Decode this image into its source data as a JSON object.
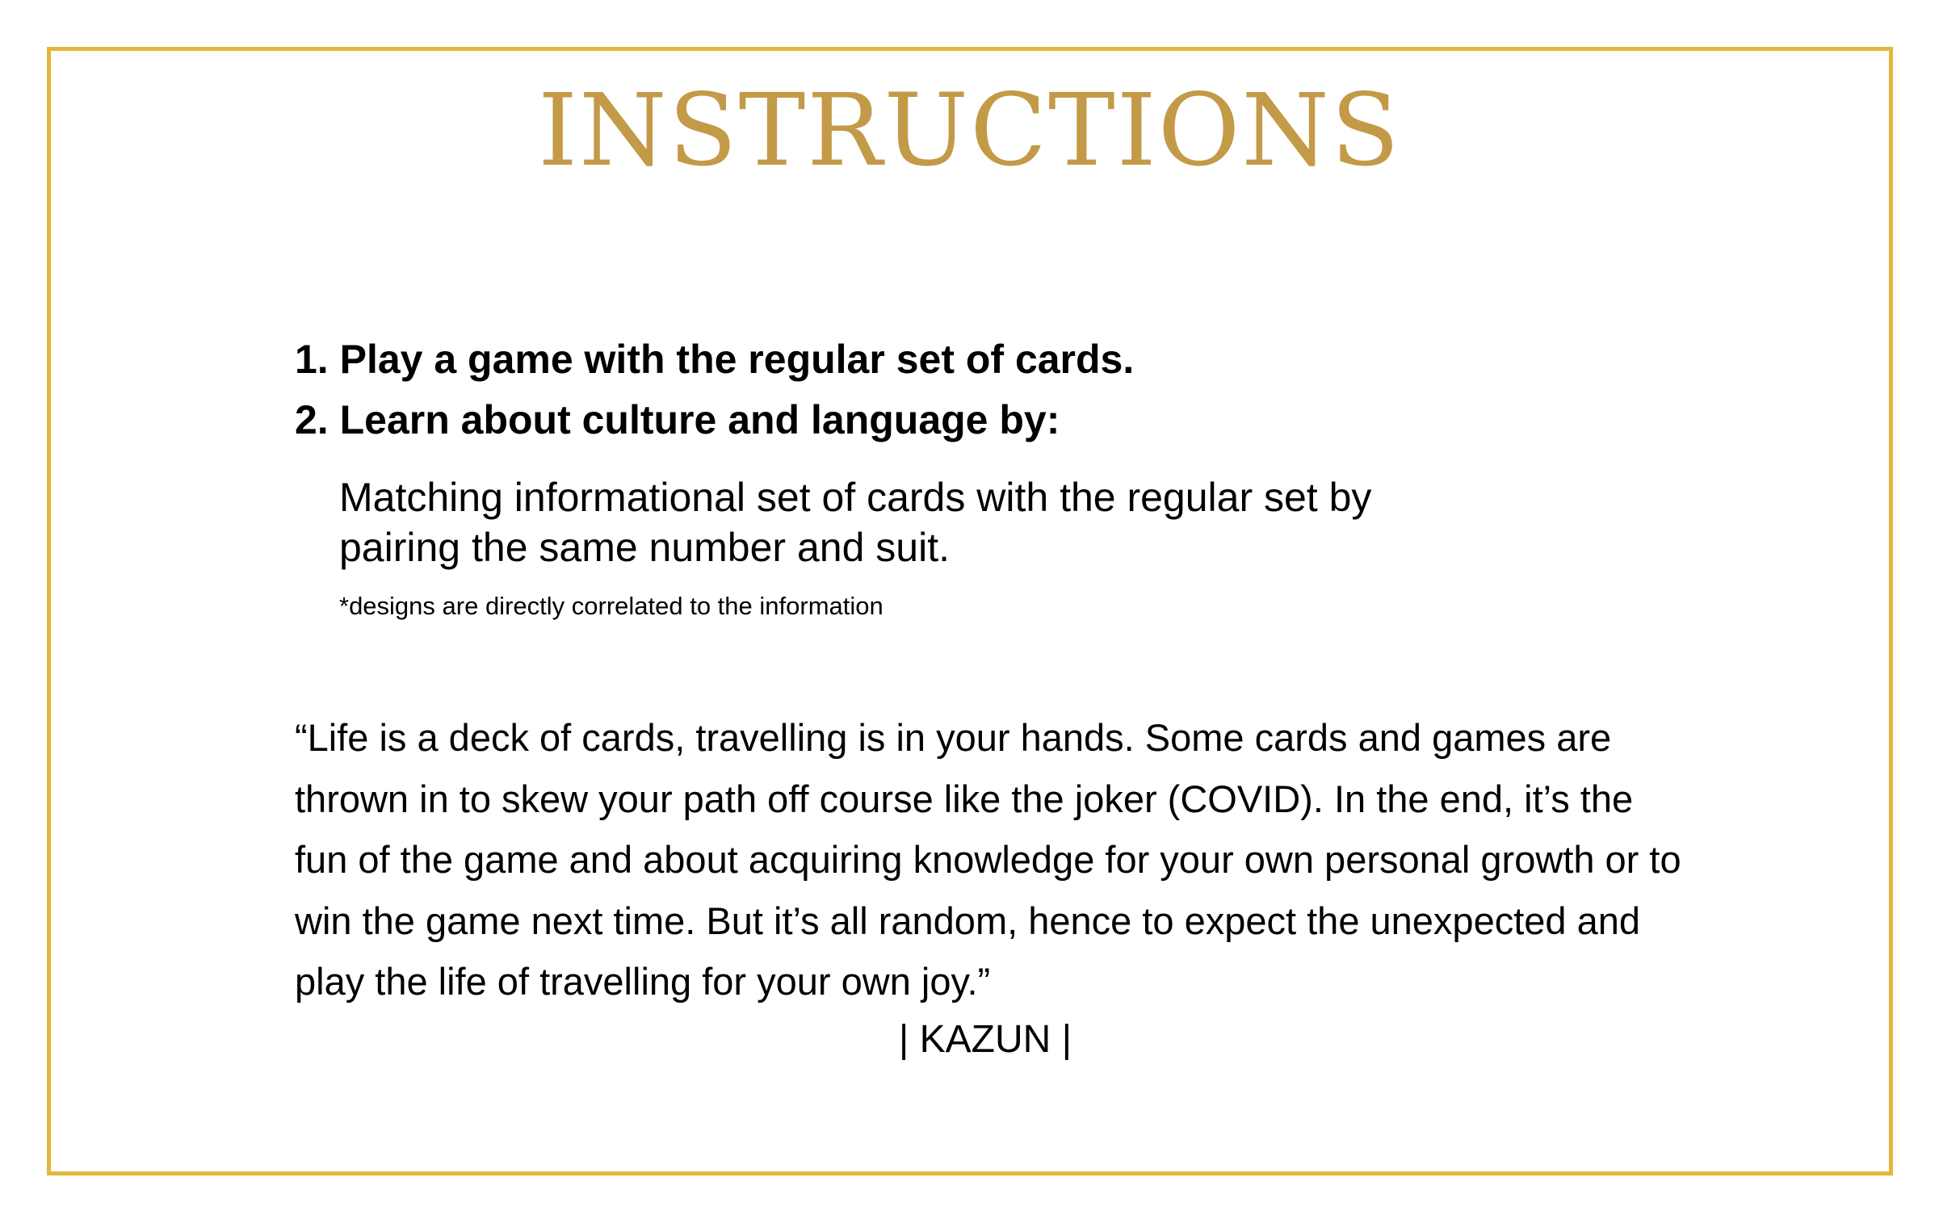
{
  "title": "INSTRUCTIONS",
  "steps": [
    "1. Play a game with the regular set of cards.",
    "2. Learn about culture and language by:"
  ],
  "detail": {
    "line1": "Matching informational set of cards with the regular set by",
    "line2": "pairing the same number and suit."
  },
  "note": "*designs are directly correlated to the information",
  "quote": "“Life is a deck of cards, travelling is in your hands. Some cards and games are thrown in to skew your path off course like the joker (COVID). In the end, it’s the fun of the game and about acquiring knowledge for your own personal growth or to win the game next time. But it’s all random, hence to expect the unexpected and play the life of travelling for your own joy.”",
  "author": "| KAZUN |",
  "colors": {
    "border": "#E2B73C",
    "title": "#C39A47",
    "text": "#000000",
    "background": "#FFFFFF"
  }
}
